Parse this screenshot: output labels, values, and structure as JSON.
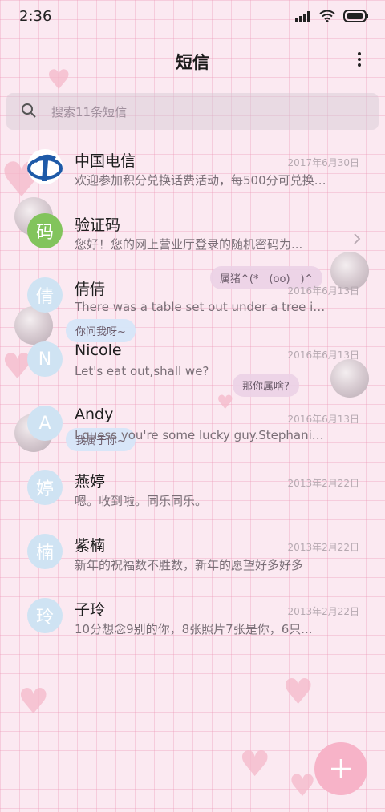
{
  "status_bar": {
    "time": "2:36"
  },
  "header": {
    "title": "短信"
  },
  "search": {
    "placeholder": "搜索11条短信"
  },
  "conversations": [
    {
      "name": "中国电信",
      "date": "2017年6月30日",
      "snippet": "欢迎参加积分兑换话费活动，每500分可兑换话费...",
      "avatar": "china-telecom-logo"
    },
    {
      "name": "验证码",
      "date": "",
      "snippet": "您好！您的网上营业厅登录的随机密码为...",
      "avatar": "码"
    },
    {
      "name": "倩倩",
      "date": "2016年6月13日",
      "snippet": "There was a table set out under a tree in front of the house",
      "avatar": "倩"
    },
    {
      "name": "Nicole",
      "date": "2016年6月13日",
      "snippet": "Let's eat out,shall we?",
      "avatar": "N"
    },
    {
      "name": "Andy",
      "date": "2016年6月13日",
      "snippet": "I guess you're some lucky guy.Stephanie said",
      "avatar": "A"
    },
    {
      "name": "燕婷",
      "date": "2013年2月22日",
      "snippet": "嗯。收到啦。同乐同乐。",
      "avatar": "婷"
    },
    {
      "name": "紫楠",
      "date": "2013年2月22日",
      "snippet": "新年的祝福数不胜数，新年的愿望好多好多",
      "avatar": "楠"
    },
    {
      "name": "子玲",
      "date": "2013年2月22日",
      "snippet": "10分想念9别的你，8张照片7张是你，6只...",
      "avatar": "玲"
    }
  ],
  "theme_stickers": [
    "属猪^(*￣(oo)￣)^",
    "你问我呀~",
    "那你属啥?",
    "我属于你~"
  ],
  "fab": {
    "icon": "plus-icon"
  },
  "colors": {
    "background": "#fbe9f1",
    "grid": "#ec96b4",
    "fab": "#f7b3c8",
    "avatar": "#cfe3f3",
    "avatar_green": "#82c45c"
  }
}
